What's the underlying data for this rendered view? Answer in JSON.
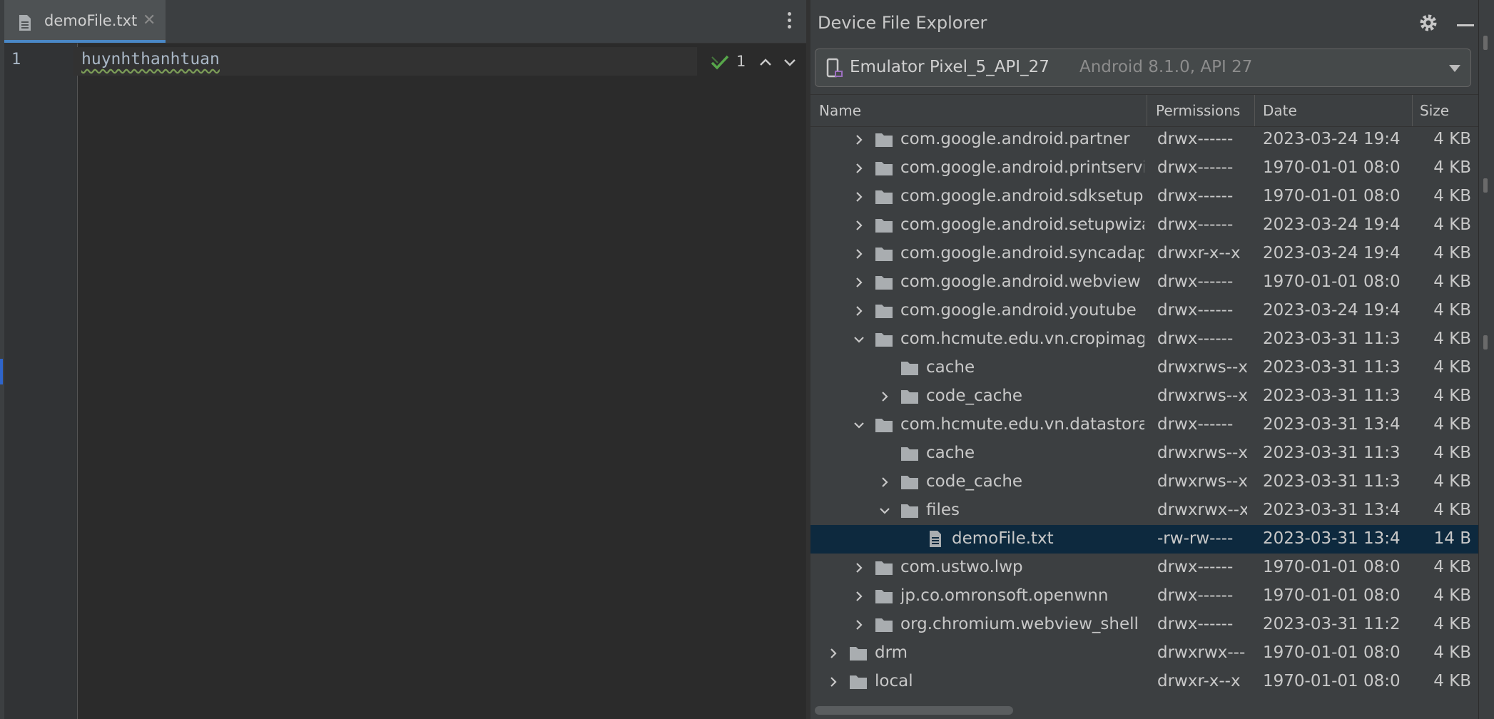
{
  "editor": {
    "tab_label": "demoFile.txt",
    "line_number": "1",
    "content": "huynhthanhtuan",
    "inspection_count": "1"
  },
  "device_file_explorer": {
    "title": "Device File Explorer",
    "device": {
      "name": "Emulator Pixel_5_API_27",
      "detail": "Android 8.1.0, API 27"
    },
    "columns": [
      "Name",
      "Permissions",
      "Date",
      "Size"
    ],
    "rows": [
      {
        "name": "com.google.android.partner",
        "permissions": "drwx------",
        "date": "2023-03-24 19:4",
        "size": "4 KB",
        "depth": 2,
        "state": "collapsed",
        "type": "folder"
      },
      {
        "name": "com.google.android.printservice",
        "permissions": "drwx------",
        "date": "1970-01-01 08:0",
        "size": "4 KB",
        "depth": 2,
        "state": "collapsed",
        "type": "folder"
      },
      {
        "name": "com.google.android.sdksetup",
        "permissions": "drwx------",
        "date": "1970-01-01 08:0",
        "size": "4 KB",
        "depth": 2,
        "state": "collapsed",
        "type": "folder"
      },
      {
        "name": "com.google.android.setupwizard",
        "permissions": "drwx------",
        "date": "2023-03-24 19:4",
        "size": "4 KB",
        "depth": 2,
        "state": "collapsed",
        "type": "folder"
      },
      {
        "name": "com.google.android.syncadapters",
        "permissions": "drwxr-x--x",
        "date": "2023-03-24 19:4",
        "size": "4 KB",
        "depth": 2,
        "state": "collapsed",
        "type": "folder"
      },
      {
        "name": "com.google.android.webview",
        "permissions": "drwx------",
        "date": "1970-01-01 08:0",
        "size": "4 KB",
        "depth": 2,
        "state": "collapsed",
        "type": "folder"
      },
      {
        "name": "com.google.android.youtube",
        "permissions": "drwx------",
        "date": "2023-03-24 19:4",
        "size": "4 KB",
        "depth": 2,
        "state": "collapsed",
        "type": "folder"
      },
      {
        "name": "com.hcmute.edu.vn.cropimage",
        "permissions": "drwx------",
        "date": "2023-03-31 11:3",
        "size": "4 KB",
        "depth": 2,
        "state": "expanded",
        "type": "folder"
      },
      {
        "name": "cache",
        "permissions": "drwxrws--x",
        "date": "2023-03-31 11:3",
        "size": "4 KB",
        "depth": 3,
        "state": "none",
        "type": "folder"
      },
      {
        "name": "code_cache",
        "permissions": "drwxrws--x",
        "date": "2023-03-31 11:3",
        "size": "4 KB",
        "depth": 3,
        "state": "collapsed",
        "type": "folder"
      },
      {
        "name": "com.hcmute.edu.vn.datastorage",
        "permissions": "drwx------",
        "date": "2023-03-31 13:4",
        "size": "4 KB",
        "depth": 2,
        "state": "expanded",
        "type": "folder"
      },
      {
        "name": "cache",
        "permissions": "drwxrws--x",
        "date": "2023-03-31 11:3",
        "size": "4 KB",
        "depth": 3,
        "state": "none",
        "type": "folder"
      },
      {
        "name": "code_cache",
        "permissions": "drwxrws--x",
        "date": "2023-03-31 11:3",
        "size": "4 KB",
        "depth": 3,
        "state": "collapsed",
        "type": "folder"
      },
      {
        "name": "files",
        "permissions": "drwxrwx--x",
        "date": "2023-03-31 13:4",
        "size": "4 KB",
        "depth": 3,
        "state": "expanded",
        "type": "folder"
      },
      {
        "name": "demoFile.txt",
        "permissions": "-rw-rw----",
        "date": "2023-03-31 13:4",
        "size": "14 B",
        "depth": 4,
        "state": "none",
        "type": "file",
        "selected": true
      },
      {
        "name": "com.ustwo.lwp",
        "permissions": "drwx------",
        "date": "1970-01-01 08:0",
        "size": "4 KB",
        "depth": 2,
        "state": "collapsed",
        "type": "folder"
      },
      {
        "name": "jp.co.omronsoft.openwnn",
        "permissions": "drwx------",
        "date": "1970-01-01 08:0",
        "size": "4 KB",
        "depth": 2,
        "state": "collapsed",
        "type": "folder"
      },
      {
        "name": "org.chromium.webview_shell",
        "permissions": "drwx------",
        "date": "2023-03-31 11:2",
        "size": "4 KB",
        "depth": 2,
        "state": "collapsed",
        "type": "folder"
      },
      {
        "name": "drm",
        "permissions": "drwxrwx---",
        "date": "1970-01-01 08:0",
        "size": "4 KB",
        "depth": 1,
        "state": "collapsed",
        "type": "folder"
      },
      {
        "name": "local",
        "permissions": "drwxr-x--x",
        "date": "1970-01-01 08:0",
        "size": "4 KB",
        "depth": 1,
        "state": "collapsed",
        "type": "folder"
      }
    ]
  },
  "colors": {
    "background": "#2b2b2b",
    "panel": "#3c3f41",
    "selection": "#0d293e",
    "accent": "#4a88c7",
    "folder": "#a9adb0",
    "check": "#57a64a"
  },
  "icons": [
    "text-file-icon",
    "close-icon",
    "more-vert-icon",
    "check-icon",
    "chevron-up-icon",
    "chevron-down-icon",
    "gear-icon",
    "minimize-icon",
    "device-icon",
    "folder-icon",
    "chevron-right-icon"
  ]
}
